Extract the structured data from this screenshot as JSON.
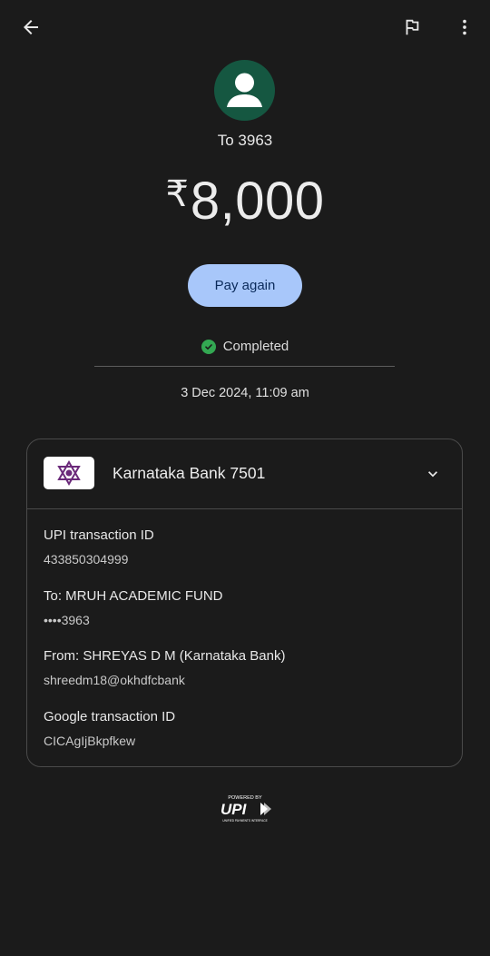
{
  "header": {
    "back_icon": "arrow-left-icon",
    "flag_icon": "flag-icon",
    "more_icon": "more-vertical-icon"
  },
  "recipient": {
    "avatar_icon": "person-icon",
    "avatar_color": "#155741",
    "label": "To 3963"
  },
  "amount": {
    "currency": "₹",
    "value": "8,000"
  },
  "actions": {
    "pay_again_label": "Pay again",
    "pay_again_color": "#a8c7fa"
  },
  "status": {
    "icon": "check-circle-icon",
    "text": "Completed",
    "color": "#33a852"
  },
  "timestamp": "3 Dec 2024, 11:09 am",
  "details": {
    "bank_logo_icon": "karnataka-bank-logo-icon",
    "bank_name": "Karnataka Bank 7501",
    "expand_icon": "chevron-down-icon",
    "rows": [
      {
        "label": "UPI transaction ID",
        "value": "433850304999"
      },
      {
        "label": "To: MRUH ACADEMIC FUND",
        "value": "••••3963"
      },
      {
        "label": "From: SHREYAS D M (Karnataka Bank)",
        "value": "shreedm18@okhdfcbank"
      },
      {
        "label": "Google transaction ID",
        "value": "CICAgIjBkpfkew"
      }
    ]
  },
  "footer": {
    "powered_by": "POWERED BY",
    "upi_logo": "UPI",
    "upi_tagline": "UNIFIED PAYMENTS INTERFACE"
  }
}
